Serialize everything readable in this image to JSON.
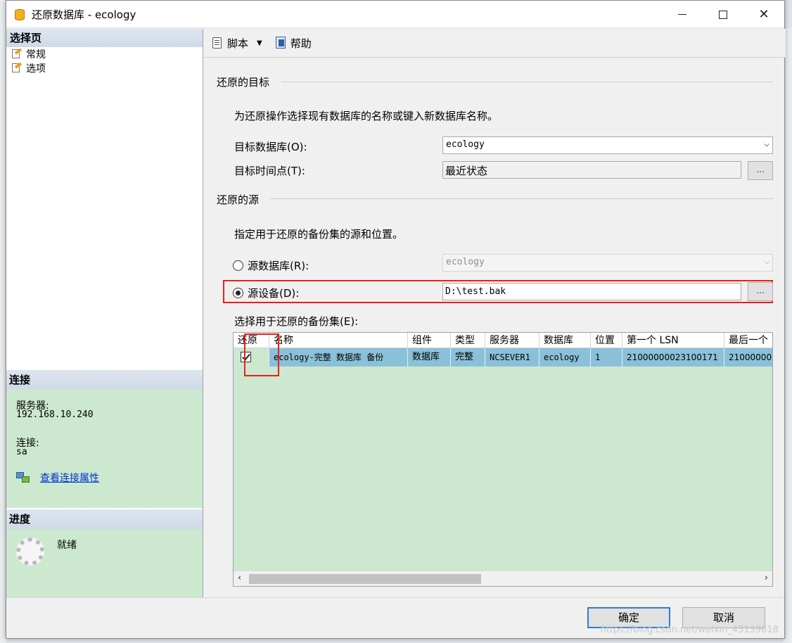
{
  "window": {
    "title": "还原数据库 - ecology"
  },
  "left_pane": {
    "select_page_header": "选择页",
    "pages": [
      {
        "label": "常规",
        "icon": "general-page-icon"
      },
      {
        "label": "选项",
        "icon": "options-page-icon"
      }
    ],
    "connection": {
      "header": "连接",
      "server_label": "服务器:",
      "server_value": "192.168.10.240",
      "conn_label": "连接:",
      "conn_value": "sa",
      "view_properties_link": "查看连接属性"
    },
    "progress": {
      "header": "进度",
      "status": "就绪"
    }
  },
  "toolbar": {
    "script_label": "脚本",
    "help_label": "帮助"
  },
  "destination": {
    "group_title": "还原的目标",
    "description": "为还原操作选择现有数据库的名称或键入新数据库名称。",
    "target_db_label": "目标数据库(O):",
    "target_db_value": "ecology",
    "target_time_label": "目标时间点(T):",
    "target_time_value": "最近状态",
    "ellipsis": "..."
  },
  "source": {
    "group_title": "还原的源",
    "description": "指定用于还原的备份集的源和位置。",
    "source_db_label": "源数据库(R):",
    "source_db_value": "ecology",
    "source_device_label": "源设备(D):",
    "source_device_value": "D:\\test.bak",
    "selected_source": "device",
    "backup_sets_label": "选择用于还原的备份集(E):"
  },
  "backup_grid": {
    "columns": [
      "还原",
      "名称",
      "组件",
      "类型",
      "服务器",
      "数据库",
      "位置",
      "第一个 LSN",
      "最后一个"
    ],
    "rows": [
      {
        "restore": true,
        "name": "ecology-完整 数据库 备份",
        "component": "数据库",
        "type": "完整",
        "server": "NCSEVER1",
        "database": "ecology",
        "position": "1",
        "first_lsn": "21000000023100171",
        "last_lsn": "210000000"
      }
    ]
  },
  "footer": {
    "ok_label": "确定",
    "cancel_label": "取消",
    "watermark": "https://blog.csdn.net/weixin_43139618"
  },
  "colors": {
    "highlight_red": "#e8201a",
    "grid_background": "#cce8cf",
    "selected_row": "#8bc1d8",
    "link_blue": "#0033cc"
  }
}
